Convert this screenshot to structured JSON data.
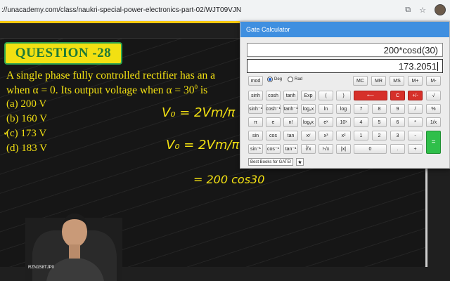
{
  "browser": {
    "url": "://unacademy.com/class/naukri-special-power-electronics-part-02/WJT09VJN"
  },
  "slide": {
    "badge": "QUESTION -28",
    "question_line1": "A single phase fully controlled rectifier has an a",
    "question_line2": "when α = 0. Its output voltage when α = 30",
    "question_line2_sup": "0",
    "question_line2_tail": "is",
    "options": [
      "(a) 200 V",
      "(b) 160 V",
      "(c) 173 V",
      "(d) 183 V"
    ],
    "tick_mark": "✓",
    "handwriting": {
      "line1": "V₀ = 2Vm/π",
      "line2": "V₀ =  2Vm/π",
      "line3": "= 200 cos30"
    }
  },
  "presenter": {
    "cam_tag": "RZN1S8TJP0"
  },
  "calculator": {
    "title": "Gate Calculator",
    "expression": "200*cosd(30)",
    "result": "173.2051",
    "mode": {
      "deg_label": "Deg",
      "rad_label": "Rad",
      "selected": "Deg"
    },
    "keys": {
      "mod": "mod",
      "mc": "MC",
      "mr": "MR",
      "ms": "MS",
      "mplus": "M+",
      "mminus": "M-",
      "sinh": "sinh",
      "cosh": "cosh",
      "tanh": "tanh",
      "exp": "Exp",
      "lparen": "(",
      "rparen": ")",
      "backspace": "⟵",
      "c": "C",
      "plusminus": "+/-",
      "sqrt": "√",
      "asinh": "sinh⁻¹",
      "acosh": "cosh⁻¹",
      "atanh": "tanh⁻¹",
      "log2x": "log₂x",
      "ln": "ln",
      "log": "log",
      "k7": "7",
      "k8": "8",
      "k9": "9",
      "div": "/",
      "pct": "%",
      "pi": "π",
      "e": "e",
      "fact": "n!",
      "logyx": "logᵧx",
      "ex": "eˣ",
      "tenx": "10ˣ",
      "k4": "4",
      "k5": "5",
      "k6": "6",
      "mul": "*",
      "inv": "1/x",
      "sin": "sin",
      "cos": "cos",
      "tan": "tan",
      "xy": "xʸ",
      "x3": "x³",
      "x2": "x²",
      "k1": "1",
      "k2": "2",
      "k3": "3",
      "minus": "-",
      "equals": "=",
      "asin": "sin⁻¹",
      "acos": "cos⁻¹",
      "atan": "tan⁻¹",
      "cbrt": "∛x",
      "yroot": "ʸ√x",
      "abs": "|x|",
      "k0": "0",
      "dot": ".",
      "plus": "+"
    },
    "books_label": "Best Books for GATE!",
    "star_label": "★"
  }
}
